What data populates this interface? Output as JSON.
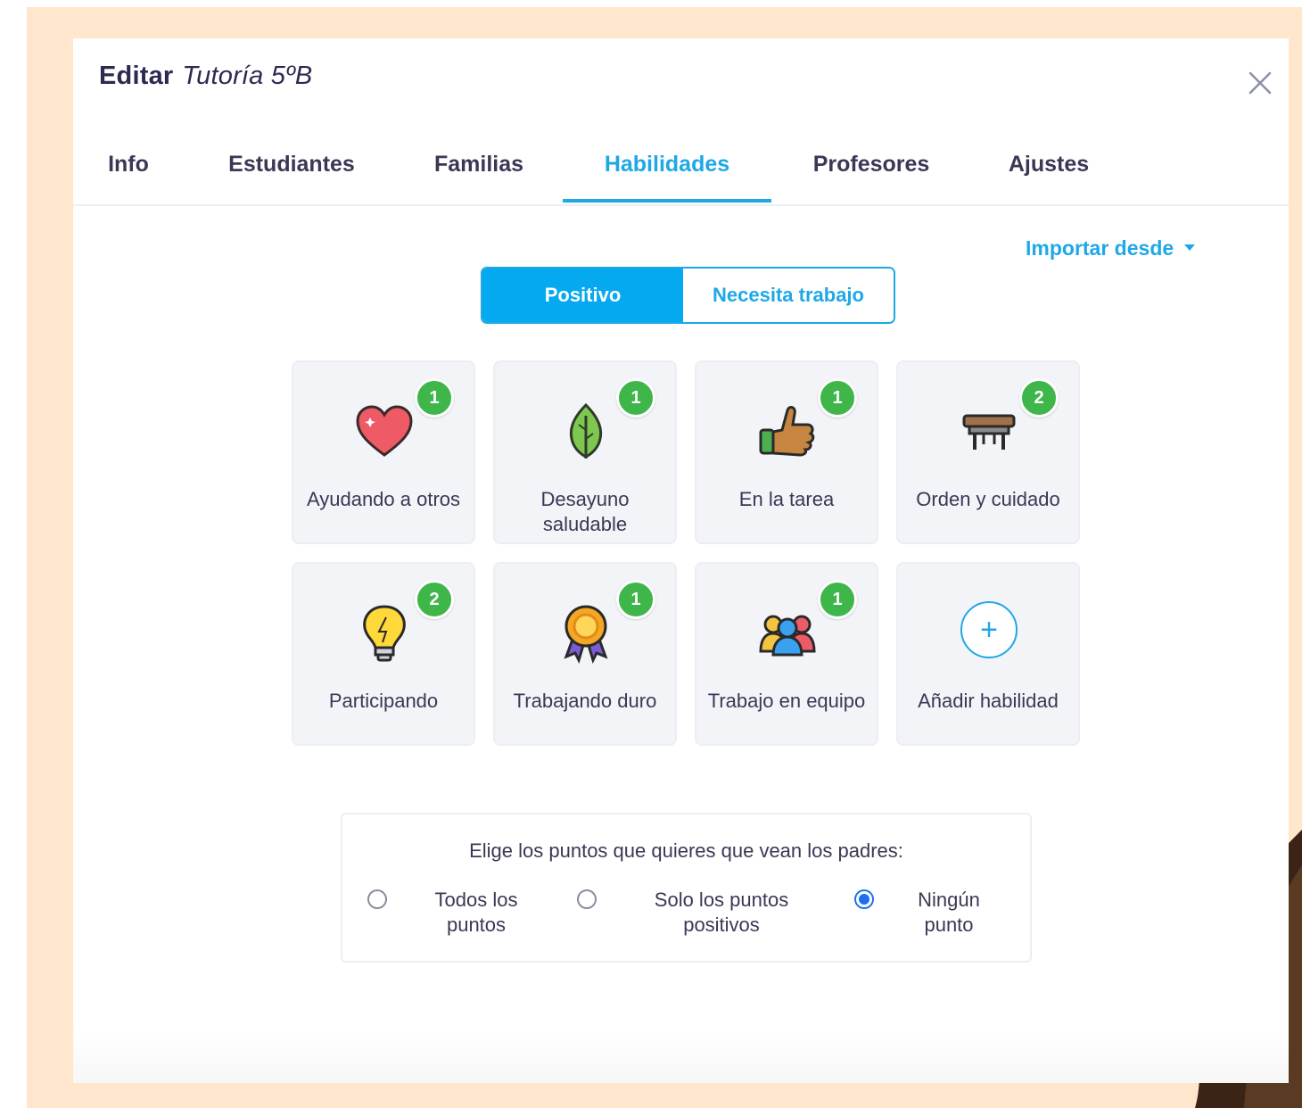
{
  "modal": {
    "title_prefix": "Editar",
    "class_name": "Tutoría 5ºB"
  },
  "tabs": [
    {
      "label": "Info",
      "active": false
    },
    {
      "label": "Estudiantes",
      "active": false
    },
    {
      "label": "Familias",
      "active": false
    },
    {
      "label": "Habilidades",
      "active": true
    },
    {
      "label": "Profesores",
      "active": false
    },
    {
      "label": "Ajustes",
      "active": false
    }
  ],
  "import": {
    "label": "Importar desde"
  },
  "segment": {
    "options": [
      "Positivo",
      "Necesita trabajo"
    ],
    "selected": "Positivo"
  },
  "skills": [
    {
      "label": "Ayudando a otros",
      "points": "1",
      "icon": "heart-icon"
    },
    {
      "label": "Desayuno saludable",
      "points": "1",
      "icon": "leaf-icon"
    },
    {
      "label": "En la tarea",
      "points": "1",
      "icon": "thumbs-up-icon"
    },
    {
      "label": "Orden y cuidado",
      "points": "2",
      "icon": "desk-icon"
    },
    {
      "label": "Participando",
      "points": "2",
      "icon": "lightbulb-icon"
    },
    {
      "label": "Trabajando duro",
      "points": "1",
      "icon": "medal-icon"
    },
    {
      "label": "Trabajo en equipo",
      "points": "1",
      "icon": "team-icon"
    }
  ],
  "add_skill": {
    "label": "Añadir habilidad",
    "icon": "plus-icon"
  },
  "parents_points": {
    "title": "Elige los puntos que quieres que vean los padres:",
    "options": [
      "Todos los puntos",
      "Solo los puntos positivos",
      "Ningún punto"
    ],
    "selected": "Ningún punto"
  },
  "colors": {
    "accent": "#1ea8e6",
    "badge": "#3fb64a",
    "background": "#ffe6cc"
  }
}
